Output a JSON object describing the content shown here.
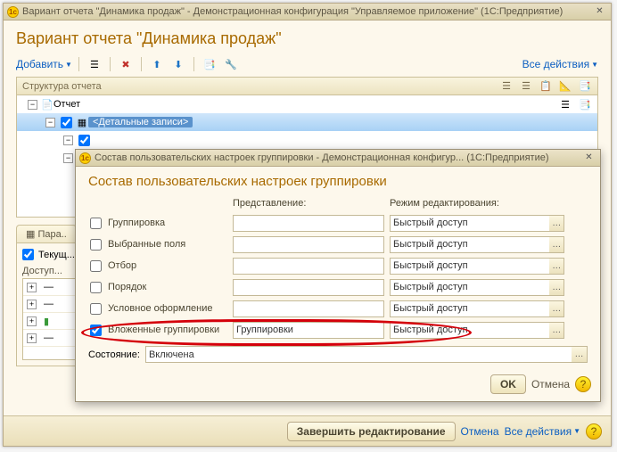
{
  "main": {
    "title": "Вариант отчета \"Динамика продаж\" - Демонстрационная конфигурация \"Управляемое приложение\"  (1С:Предприятие)",
    "page_title": "Вариант отчета \"Динамика продаж\"",
    "toolbar": {
      "add": "Добавить",
      "all_actions": "Все действия"
    },
    "tree": {
      "header": "Структура отчета",
      "nodes": {
        "report": "Отчет",
        "detail": "<Детальные записи>"
      }
    },
    "params": {
      "tab1": "Пара..",
      "current_variant": "Текущ...",
      "available": "Доступ..."
    },
    "footer": {
      "finish": "Завершить редактирование",
      "cancel": "Отмена",
      "all_actions": "Все действия"
    }
  },
  "dialog": {
    "title": "Состав пользовательских настроек группировки - Демонстрационная конфигур...  (1С:Предприятие)",
    "heading": "Состав пользовательских настроек группировки",
    "col_presentation": "Представление:",
    "col_mode": "Режим редактирования:",
    "mode_value": "Быстрый доступ",
    "rows": {
      "r0": {
        "label": "Группировка",
        "input": ""
      },
      "r1": {
        "label": "Выбранные поля",
        "input": ""
      },
      "r2": {
        "label": "Отбор",
        "input": ""
      },
      "r3": {
        "label": "Порядок",
        "input": ""
      },
      "r4": {
        "label": "Условное оформление",
        "input": ""
      },
      "r5": {
        "label": "Вложенные группировки",
        "input": "Группировки"
      }
    },
    "state_label": "Состояние:",
    "state_value": "Включена",
    "ok": "OK",
    "cancel": "Отмена"
  }
}
